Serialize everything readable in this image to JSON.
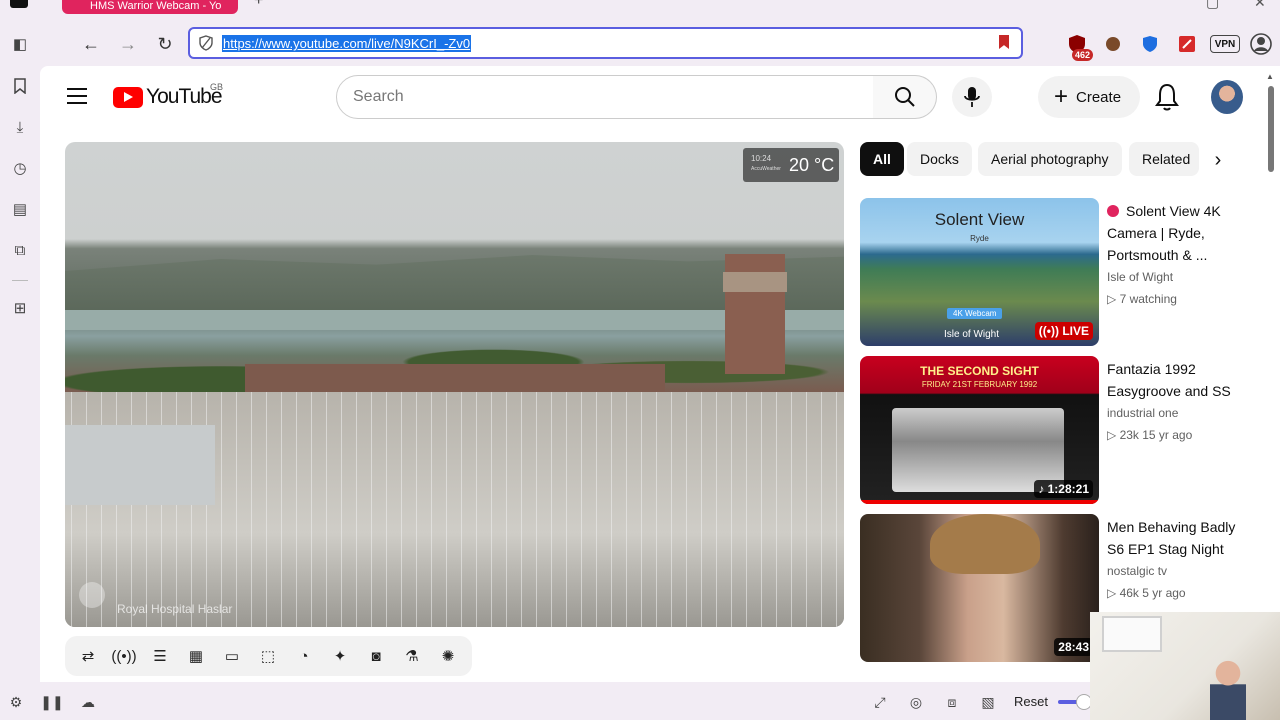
{
  "browser": {
    "tab_title": "HMS Warrior Webcam - Yo",
    "url": "https://www.youtube.com/live/N9KCrI_-Zv0",
    "extension_badge": "462",
    "vpn_label": "VPN",
    "status_reset": "Reset"
  },
  "youtube": {
    "logo_text": "YouTube",
    "region": "GB",
    "search_placeholder": "Search",
    "create_label": "Create"
  },
  "video": {
    "weather_time": "10:24",
    "weather_brand": "AccuWeather",
    "temperature": "20 °C",
    "watermark": "Royal Hospital Haslar"
  },
  "chips": [
    "All",
    "Docks",
    "Aerial photography",
    "Related"
  ],
  "recommendations": [
    {
      "title": "Solent View 4K Camera | Ryde, Portsmouth & ...",
      "channel": "Isle of Wight",
      "meta": "7 watching",
      "badge": "LIVE",
      "thumb_title": "Solent View",
      "thumb_sub": "Ryde",
      "thumb_tag": "4K Webcam",
      "thumb_brand": "Isle of Wight",
      "is_live": true
    },
    {
      "title": "Fantazia 1992 Easygroove and SS",
      "channel": "industrial one",
      "meta": "23k   15 yr ago",
      "badge": "1:28:21",
      "thumb_title": "THE SECOND SIGHT",
      "thumb_sub": "FRIDAY 21ST FEBRUARY 1992",
      "is_live": false
    },
    {
      "title": "Men Behaving Badly S6 EP1  Stag Night",
      "channel": "nostalgic tv",
      "meta": "46k   5 yr ago",
      "badge": "28:43",
      "is_live": false
    }
  ]
}
